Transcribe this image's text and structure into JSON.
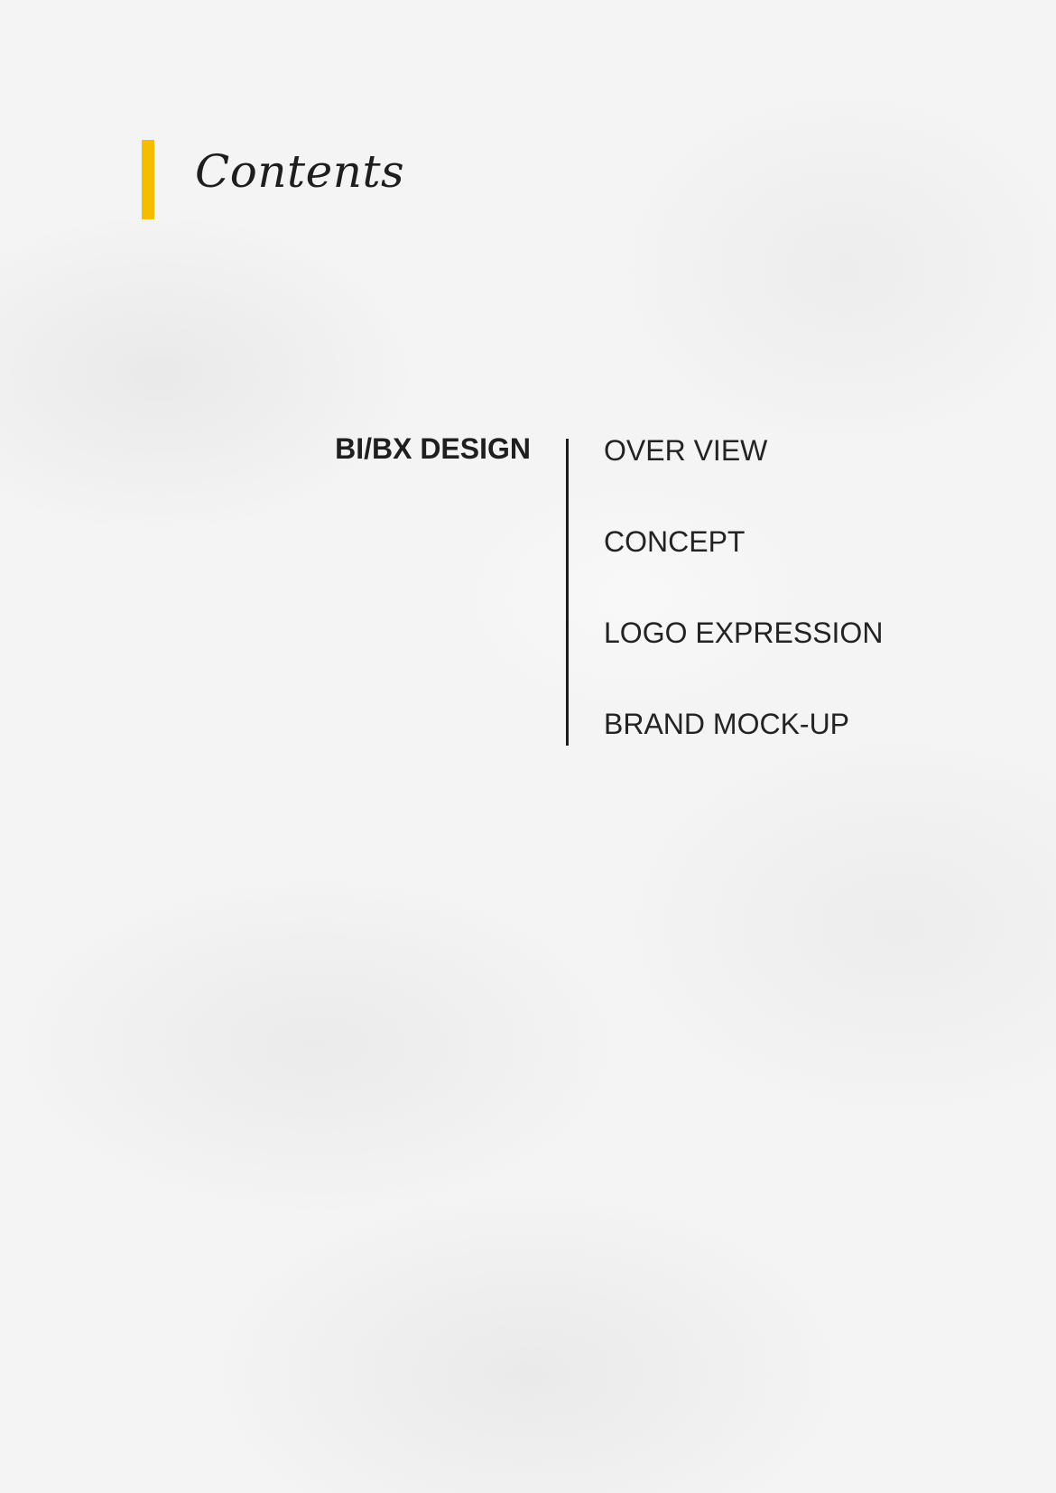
{
  "header": {
    "title": "Contents",
    "accent_color": "#f5bd00"
  },
  "section": {
    "label": "BI/BX DESIGN",
    "items": [
      {
        "label": "OVER VIEW"
      },
      {
        "label": "CONCEPT"
      },
      {
        "label": "LOGO EXPRESSION"
      },
      {
        "label": "BRAND MOCK-UP"
      }
    ]
  }
}
